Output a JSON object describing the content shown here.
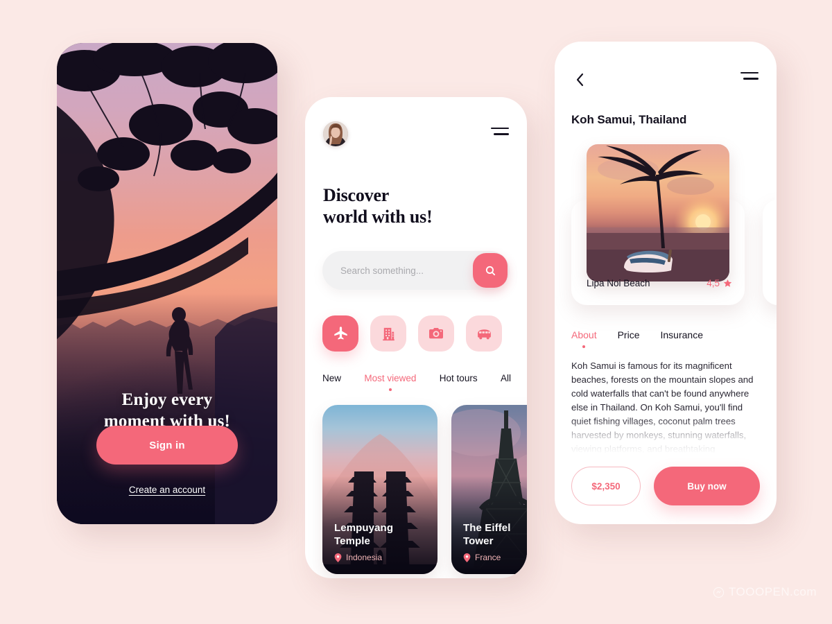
{
  "canvas": {
    "background_color": "#fbe9e6",
    "accent_color": "#f4687a",
    "accent_soft_color": "#fbd9dc",
    "dark_color": "#14111f"
  },
  "watermark": {
    "text": "TOOOPEN.com",
    "icon": "logo-icon"
  },
  "onboarding": {
    "screen_name": "Onboarding",
    "hero_photo_alt": "sunset-tree-silhouette-photo",
    "headline_line1": "Enjoy every",
    "headline_line2": "moment with us!",
    "sign_in_label": "Sign in",
    "create_account_label": "Create an account"
  },
  "discover": {
    "screen_name": "Discover",
    "avatar_alt": "user-avatar",
    "menu_icon": "hamburger-icon",
    "title_line1": "Discover",
    "title_line2": "world with us!",
    "search": {
      "placeholder": "Search something...",
      "value": "",
      "button_icon": "search-icon"
    },
    "categories": [
      {
        "name": "flights",
        "icon": "airplane-icon",
        "active": true
      },
      {
        "name": "hotels",
        "icon": "building-icon",
        "active": false
      },
      {
        "name": "photos",
        "icon": "camera-icon",
        "active": false
      },
      {
        "name": "bus-tours",
        "icon": "bus-icon",
        "active": false
      }
    ],
    "tabs": [
      {
        "label": "New",
        "active": false
      },
      {
        "label": "Most viewed",
        "active": true
      },
      {
        "label": "Hot tours",
        "active": false
      },
      {
        "label": "All",
        "active": false
      }
    ],
    "cards": [
      {
        "title_line1": "Lempuyang",
        "title_line2": "Temple",
        "country": "Indonesia",
        "pin_icon": "location-pin-icon",
        "photo_alt": "lempuyang-temple-gate-volcano-photo"
      },
      {
        "title_line1": "The Eiffel",
        "title_line2": "Tower",
        "country": "France",
        "pin_icon": "location-pin-icon",
        "photo_alt": "eiffel-tower-dusk-photo"
      }
    ]
  },
  "detail": {
    "screen_name": "Place detail",
    "back_icon": "chevron-left-icon",
    "menu_icon": "hamburger-icon",
    "title": "Koh Samui, Thailand",
    "gallery": [
      {
        "name": "Lipa Noi Beach",
        "rating": "4,5",
        "star_icon": "star-icon",
        "photo_alt": "palm-tree-boat-sunset-beach-photo"
      }
    ],
    "tabs": [
      {
        "label": "About",
        "active": true
      },
      {
        "label": "Price",
        "active": false
      },
      {
        "label": "Insurance",
        "active": false
      }
    ],
    "description": "Koh Samui is famous for its magnificent beaches, forests on the mountain slopes and cold waterfalls that can't be found anywhere else in Thailand. On Koh Samui, you'll find quiet fishing villages, coconut palm trees harvested by monkeys, stunning waterfalls, viewing platforms, and breathtaking",
    "price_label": "$2,350",
    "buy_label": "Buy now"
  }
}
